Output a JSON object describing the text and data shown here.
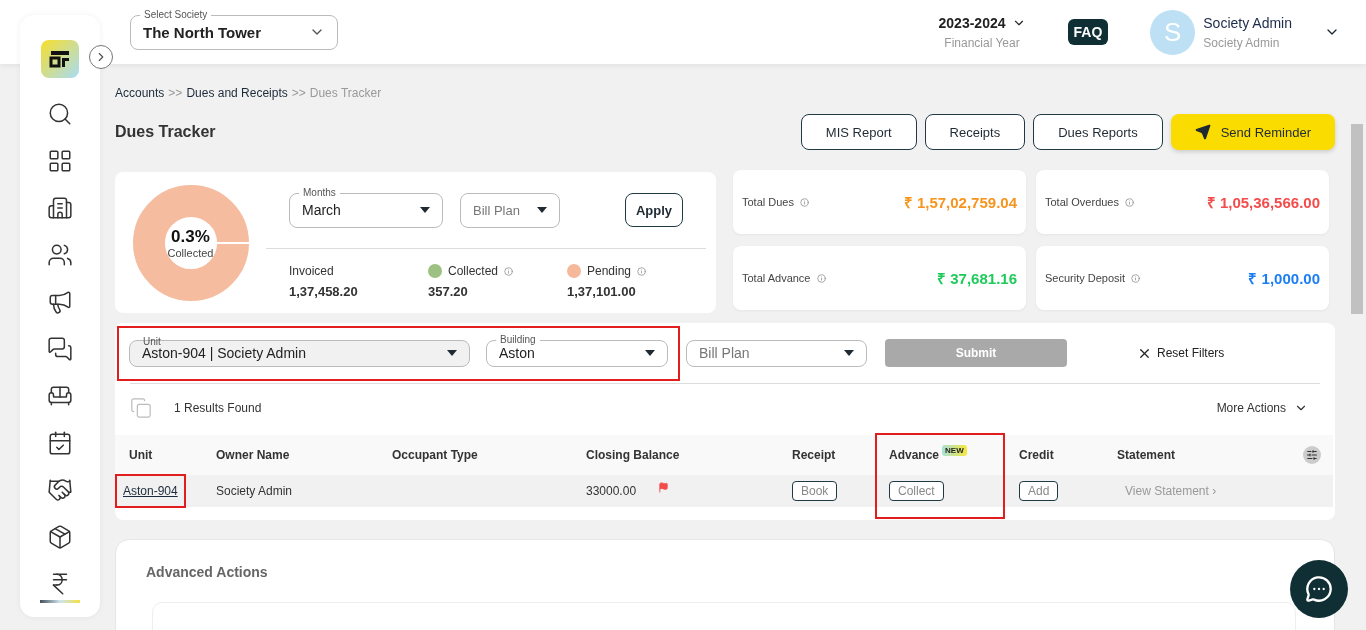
{
  "header": {
    "society_select": {
      "label": "Select Society",
      "value": "The North Tower"
    },
    "financial_year": {
      "value": "2023-2024",
      "label": "Financial Year"
    },
    "faq": "FAQ",
    "user": {
      "initial": "S",
      "name": "Society Admin",
      "role": "Society Admin"
    }
  },
  "sidebar": {
    "items": [
      {
        "selected": false
      },
      {
        "selected": false
      },
      {
        "selected": false
      },
      {
        "selected": false
      },
      {
        "selected": false
      },
      {
        "selected": false
      },
      {
        "selected": false
      },
      {
        "selected": false
      },
      {
        "selected": false
      },
      {
        "selected": false
      },
      {
        "selected": true
      }
    ]
  },
  "breadcrumb": [
    {
      "kind": "link",
      "label": "Accounts"
    },
    {
      "kind": "sep",
      "label": ">>"
    },
    {
      "kind": "link",
      "label": "Dues and Receipts"
    },
    {
      "kind": "sep",
      "label": ">>"
    },
    {
      "kind": "current",
      "label": "Dues Tracker"
    }
  ],
  "page_title": "Dues Tracker",
  "actions": [
    {
      "kind": "outline",
      "label": "MIS Report"
    },
    {
      "kind": "outline",
      "label": "Receipts"
    },
    {
      "kind": "outline",
      "label": "Dues Reports"
    },
    {
      "kind": "primary",
      "label": "Send Reminder"
    }
  ],
  "summary": {
    "donut": {
      "percent": "0.3%",
      "caption": "Collected"
    },
    "months": {
      "label": "Months",
      "value": "March"
    },
    "bill_plan": {
      "placeholder": "Bill Plan"
    },
    "apply": "Apply",
    "stats": [
      {
        "label": "Invoiced",
        "value": "1,37,458.20"
      },
      {
        "label": "Collected",
        "value": "357.20",
        "color": "#9dc183"
      },
      {
        "label": "Pending",
        "value": "1,37,101.00",
        "color": "#f5b89a"
      }
    ]
  },
  "totals": [
    {
      "label": "Total Dues",
      "amount": "₹ 1,57,02,759.04",
      "color": "#f7941d"
    },
    {
      "label": "Total Overdues",
      "amount": "₹ 1,05,36,566.00",
      "color": "#f44b4b"
    },
    {
      "label": "Total Advance",
      "amount": "₹ 37,681.16",
      "color": "#1ecb5a"
    },
    {
      "label": "Security Deposit",
      "amount": "₹ 1,000.00",
      "color": "#1c7ef5"
    }
  ],
  "filters": {
    "highlighted": true,
    "unit": {
      "label": "Unit",
      "value": "Aston-904 | Society Admin"
    },
    "building": {
      "label": "Building",
      "value": "Aston"
    },
    "bill_plan": {
      "placeholder": "Bill Plan"
    },
    "submit": {
      "label": "Submit",
      "disabled": true
    },
    "reset": "Reset Filters"
  },
  "results": "1 Results Found",
  "more_actions": "More Actions",
  "table": {
    "columns": [
      {
        "label": "Unit",
        "highlighted": false
      },
      {
        "label": "Owner Name",
        "highlighted": false
      },
      {
        "label": "Occupant Type",
        "highlighted": false
      },
      {
        "label": "Closing Balance",
        "highlighted": false
      },
      {
        "label": "Receipt",
        "highlighted": false
      },
      {
        "label": "Advance",
        "badge": "NEW",
        "highlighted": true
      },
      {
        "label": "Credit",
        "highlighted": false
      },
      {
        "label": "Statement",
        "highlighted": false
      }
    ],
    "rows": [
      {
        "cells": [
          {
            "kind": "link",
            "text": "Aston-904",
            "highlighted": true
          },
          {
            "kind": "text",
            "text": "Society Admin"
          },
          {
            "kind": "empty"
          },
          {
            "kind": "flagged",
            "text": "33000.00"
          },
          {
            "kind": "button",
            "text": "Book"
          },
          {
            "kind": "button",
            "text": "Collect"
          },
          {
            "kind": "button",
            "text": "Add"
          },
          {
            "kind": "more",
            "text": "View Statement ›"
          }
        ]
      }
    ]
  },
  "advanced_actions": "Advanced Actions"
}
